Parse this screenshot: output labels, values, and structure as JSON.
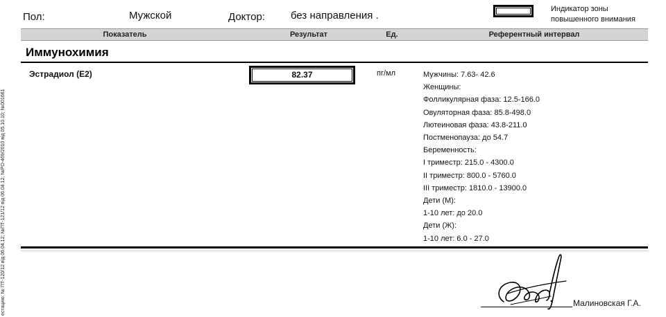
{
  "side_note": "естацию: № ПТ-120/12 від 06.04.12; №ПТ-121/12 від 06.04.12; №РО-469/2010 від 05.10.10; №001661",
  "header": {
    "sex_label": "Пол:",
    "sex_value": "Мужской",
    "doctor_label": "Доктор:",
    "doctor_value": "без направления .",
    "indicator_label": "Индикатор зоны повышенного внимания"
  },
  "table": {
    "columns": [
      "Показатель",
      "Результат",
      "Ед.",
      "Референтный интервал"
    ]
  },
  "section": {
    "title": "Иммунохимия"
  },
  "row": {
    "name": "Эстрадиол (E2)",
    "result": "82.37",
    "unit": "пг/мл",
    "reference": [
      "Мужчины: 7.63- 42.6",
      "Женщины:",
      "Фолликулярная фаза: 12.5-166.0",
      "Овуляторная фаза: 85.8-498.0",
      "Лютеиновая фаза: 43.8-211.0",
      "Постменопауза: до 54.7",
      "Беременность:",
      "I триместр: 215.0 - 4300.0",
      "II триместр: 800.0 - 5760.0",
      "III триместр: 1810.0 - 13900.0",
      "Дети (М):",
      "1-10 лет: до 20.0",
      "Дети (Ж):",
      "1-10 лет: 6.0 - 27.0"
    ]
  },
  "signature": {
    "name": "Малиновская Г.А."
  }
}
